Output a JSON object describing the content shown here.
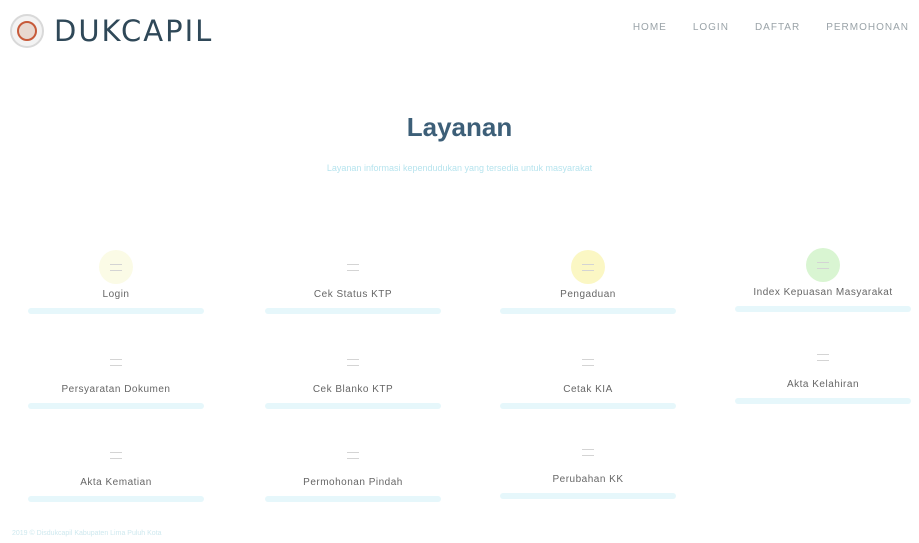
{
  "header": {
    "brand": "DUKCAPIL",
    "nav": [
      "HOME",
      "LOGIN",
      "DAFTAR",
      "PERMOHONAN"
    ]
  },
  "main": {
    "title": "Layanan",
    "subtitle": "Layanan informasi kependudukan yang tersedia untuk masyarakat"
  },
  "services": [
    {
      "label": "Login",
      "icon": "login-icon",
      "color": "#fbfbe6"
    },
    {
      "label": "Cek Status KTP",
      "icon": "document-icon",
      "color": "#ffffff"
    },
    {
      "label": "Pengaduan",
      "icon": "complaint-icon",
      "color": "#fbf7c4"
    },
    {
      "label": "Index Kepuasan Masyarakat",
      "icon": "chart-icon",
      "color": "#d9f5d2"
    },
    {
      "label": "Persyaratan Dokumen",
      "icon": "list-icon",
      "color": "#ffffff"
    },
    {
      "label": "Cek Blanko KTP",
      "icon": "card-icon",
      "color": "#ffffff"
    },
    {
      "label": "Cetak KIA",
      "icon": "print-icon",
      "color": "#ffffff"
    },
    {
      "label": "Akta Kelahiran",
      "icon": "birth-icon",
      "color": "#ffffff"
    },
    {
      "label": "Akta Kematian",
      "icon": "death-icon",
      "color": "#ffffff"
    },
    {
      "label": "Permohonan Pindah",
      "icon": "move-icon",
      "color": "#ffffff"
    },
    {
      "label": "Perubahan KK",
      "icon": "family-icon",
      "color": "#ffffff"
    }
  ],
  "footer": {
    "text": "2019 © Disdukcapil Kabupaten Lima Puluh Kota"
  }
}
